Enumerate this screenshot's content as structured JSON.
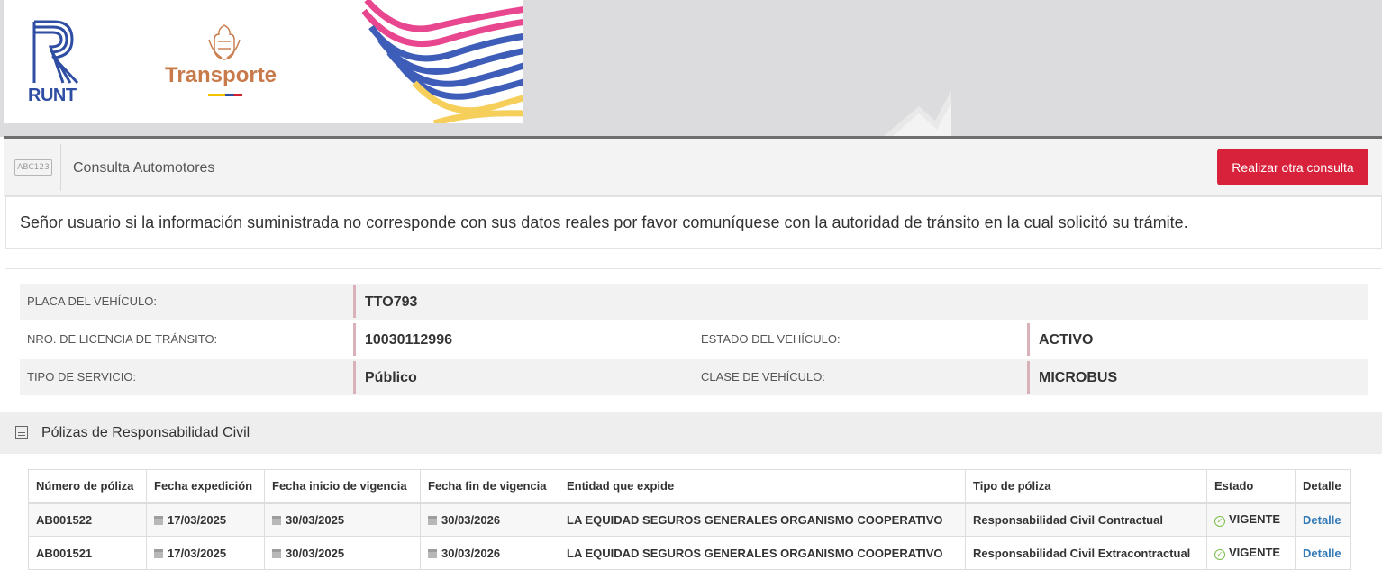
{
  "banner": {
    "runt_text": "RUNT",
    "transporte_text": "Transporte"
  },
  "header": {
    "section_icon_text": "ABC123",
    "title": "Consulta Automotores",
    "button_label": "Realizar otra consulta"
  },
  "notice": "Señor usuario si la información suministrada no corresponde con sus datos reales por favor comuníquese con la autoridad de tránsito en la cual solicitó su trámite.",
  "vehicle": {
    "placa_label": "PLACA DEL VEHÍCULO:",
    "placa_value": "TTO793",
    "licencia_label": "NRO. DE LICENCIA DE TRÁNSITO:",
    "licencia_value": "10030112996",
    "estado_label": "ESTADO DEL VEHÍCULO:",
    "estado_value": "ACTIVO",
    "servicio_label": "TIPO DE SERVICIO:",
    "servicio_value": "Público",
    "clase_label": "CLASE DE VEHÍCULO:",
    "clase_value": "MICROBUS"
  },
  "policies": {
    "section_title": "Pólizas de Responsabilidad Civil",
    "columns": [
      "Número de póliza",
      "Fecha expedición",
      "Fecha inicio de vigencia",
      "Fecha fin de vigencia",
      "Entidad que expide",
      "Tipo de póliza",
      "Estado",
      "Detalle"
    ],
    "rows": [
      {
        "numero": "AB001522",
        "expedicion": "17/03/2025",
        "inicio": "30/03/2025",
        "fin": "30/03/2026",
        "entidad": "LA EQUIDAD SEGUROS GENERALES ORGANISMO COOPERATIVO",
        "tipo": "Responsabilidad Civil Contractual",
        "estado": "VIGENTE",
        "detalle": "Detalle"
      },
      {
        "numero": "AB001521",
        "expedicion": "17/03/2025",
        "inicio": "30/03/2025",
        "fin": "30/03/2026",
        "entidad": "LA EQUIDAD SEGUROS GENERALES ORGANISMO COOPERATIVO",
        "tipo": "Responsabilidad Civil Extracontractual",
        "estado": "VIGENTE",
        "detalle": "Detalle"
      }
    ]
  },
  "colors": {
    "accent_red": "#d8213a",
    "runt_blue": "#2f4ea3",
    "status_green": "#7bbf4a",
    "link_blue": "#337ab7"
  },
  "icons": [
    "runt-logo",
    "colombia-seal-icon",
    "abc123-plate-icon",
    "list-icon",
    "calendar-icon",
    "check-circle-icon"
  ]
}
